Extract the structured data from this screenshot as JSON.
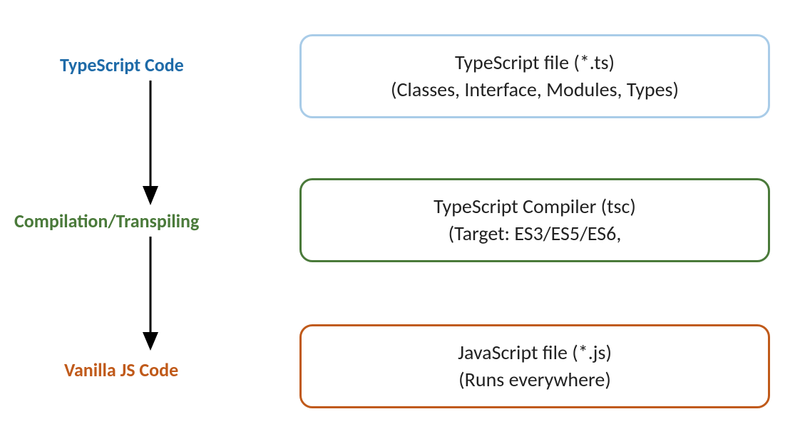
{
  "diagram": {
    "left": {
      "stage1": "TypeScript Code",
      "stage2": "Compilation/Transpiling",
      "stage3": "Vanilla JS Code"
    },
    "boxes": {
      "box1": {
        "line1": "TypeScript file (*.ts)",
        "line2": "(Classes, Interface, Modules, Types)"
      },
      "box2": {
        "line1": "TypeScript Compiler (tsc)",
        "line2": "(Target: ES3/ES5/ES6,"
      },
      "box3": {
        "line1": "JavaScript file (*.js)",
        "line2": "(Runs everywhere)"
      }
    },
    "colors": {
      "blue": "#1f6ba8",
      "green": "#4a7a3a",
      "orange": "#c05a1a",
      "lightblue": "#a9cce8"
    }
  }
}
